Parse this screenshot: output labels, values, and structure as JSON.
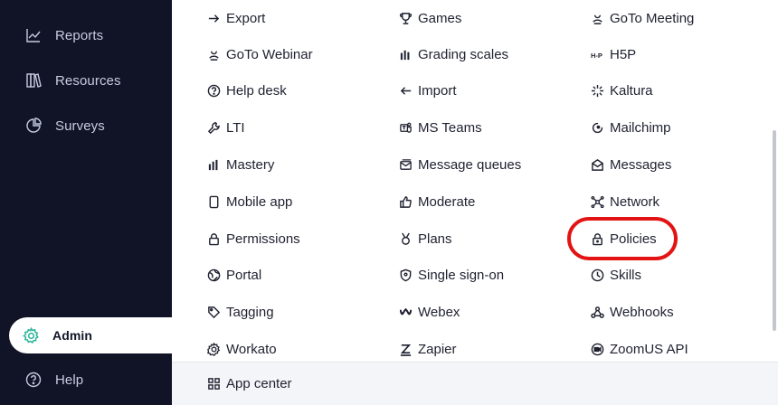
{
  "sidebar": {
    "items": [
      {
        "label": "Reports",
        "icon": "chart-line-icon"
      },
      {
        "label": "Resources",
        "icon": "books-icon"
      },
      {
        "label": "Surveys",
        "icon": "pie-chart-icon"
      },
      {
        "label": "Admin",
        "icon": "gear-icon"
      },
      {
        "label": "Help",
        "icon": "question-circle-icon"
      }
    ]
  },
  "menu": {
    "col1": [
      "Export",
      "GoTo Webinar",
      "Help desk",
      "LTI",
      "Mastery",
      "Mobile app",
      "Permissions",
      "Portal",
      "Tagging",
      "Workato"
    ],
    "col2": [
      "Games",
      "Grading scales",
      "Import",
      "MS Teams",
      "Message queues",
      "Moderate",
      "Plans",
      "Single sign-on",
      "Webex",
      "Zapier"
    ],
    "col3": [
      "GoTo Meeting",
      "H5P",
      "Kaltura",
      "Mailchimp",
      "Messages",
      "Network",
      "Policies",
      "Skills",
      "Webhooks",
      "ZoomUS API"
    ]
  },
  "footer": {
    "app_center_label": "App center"
  },
  "colors": {
    "sidebar_bg": "#111426",
    "highlight": "#e31313",
    "accent_admin": "#2bb39a"
  }
}
